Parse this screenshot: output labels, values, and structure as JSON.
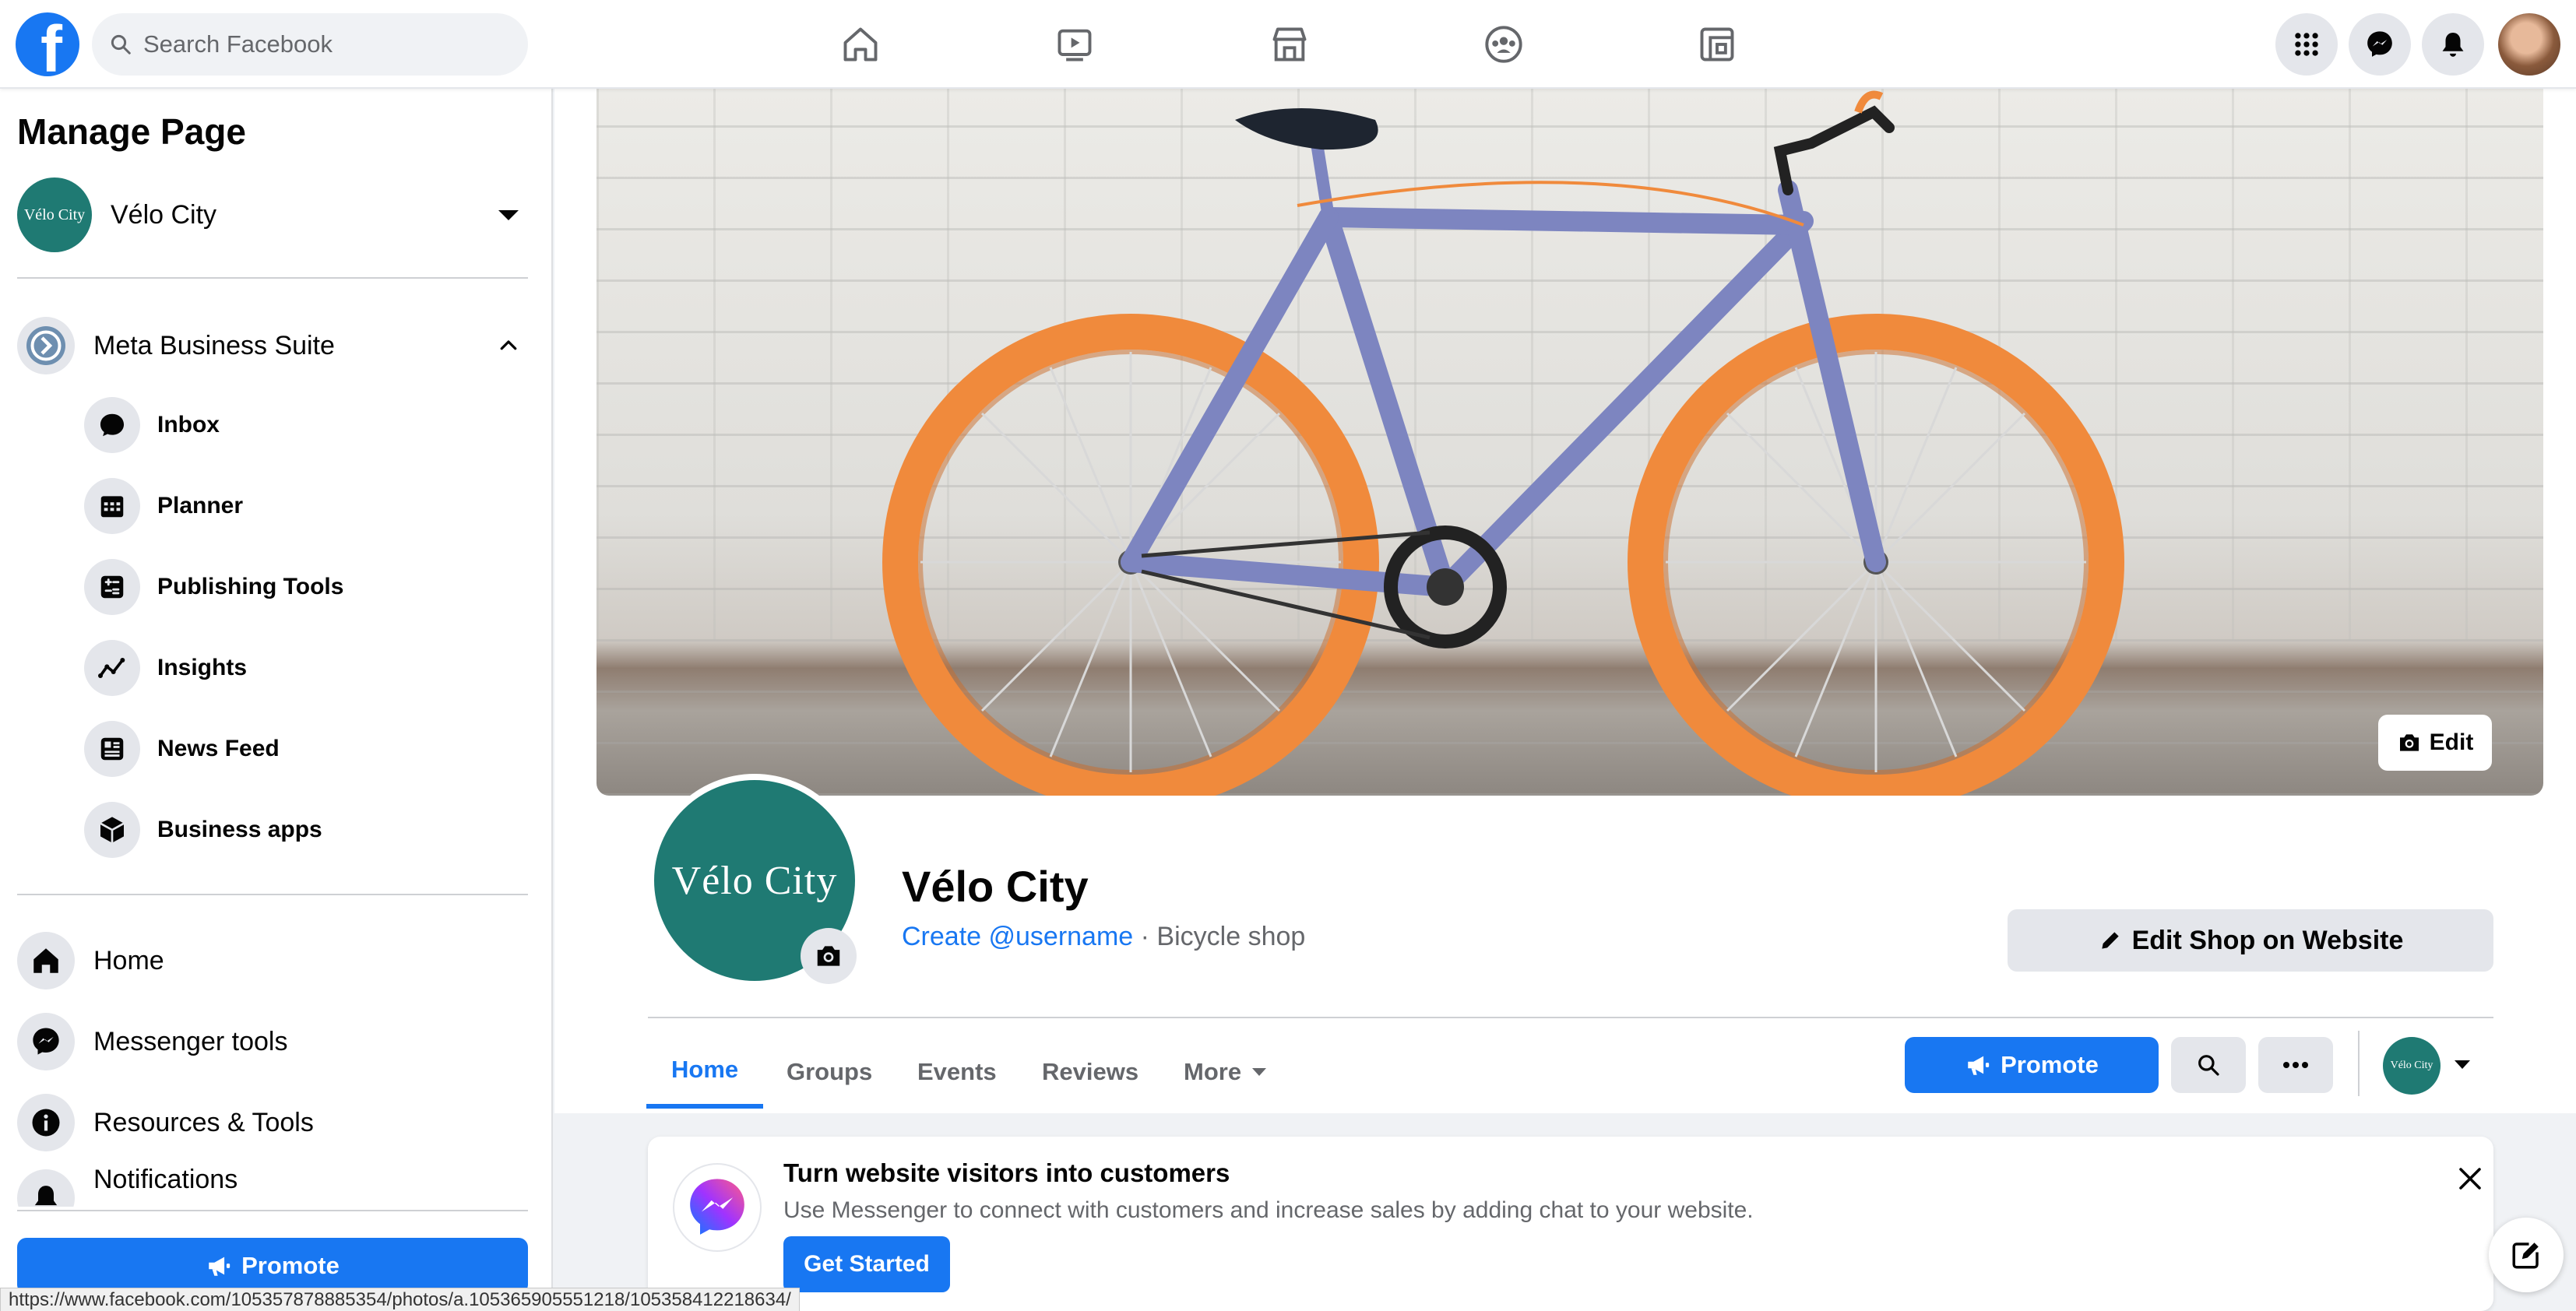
{
  "topbar": {
    "logo": "f",
    "search_placeholder": "Search Facebook",
    "nav_icons": [
      "home-icon",
      "watch-icon",
      "marketplace-icon",
      "groups-icon",
      "gaming-icon"
    ],
    "right_icons": [
      "menu-grid-icon",
      "messenger-icon",
      "notifications-icon"
    ]
  },
  "sidebar": {
    "title": "Manage Page",
    "page_name": "Vélo City",
    "page_avatar_text": "Vélo City",
    "business_suite": "Meta Business Suite",
    "suite_items": [
      {
        "label": "Inbox",
        "icon": "chat-bubble-icon"
      },
      {
        "label": "Planner",
        "icon": "calendar-icon"
      },
      {
        "label": "Publishing Tools",
        "icon": "publishing-tools-icon"
      },
      {
        "label": "Insights",
        "icon": "insights-icon"
      },
      {
        "label": "News Feed",
        "icon": "news-feed-icon"
      },
      {
        "label": "Business apps",
        "icon": "cube-icon"
      }
    ],
    "main_items": [
      {
        "label": "Home",
        "icon": "home-icon"
      },
      {
        "label": "Messenger tools",
        "icon": "messenger-icon"
      },
      {
        "label": "Resources & Tools",
        "icon": "info-icon"
      },
      {
        "label": "Notifications",
        "icon": "bell-icon"
      }
    ],
    "promote_label": "Promote"
  },
  "profile": {
    "cover_edit_label": "Edit",
    "avatar_text": "Vélo City",
    "name": "Vélo City",
    "username_link": "Create @username",
    "separator": " · ",
    "category": "Bicycle shop",
    "edit_shop_label": "Edit Shop on Website",
    "tabs": [
      "Home",
      "Groups",
      "Events",
      "Reviews",
      "More"
    ],
    "active_tab": "Home",
    "promote_label": "Promote",
    "mini_avatar_text": "Vélo City"
  },
  "promo": {
    "title": "Turn website visitors into customers",
    "text": "Use Messenger to connect with customers and increase sales by adding chat to your website.",
    "button": "Get Started"
  },
  "status_bar": {
    "url": "https://www.facebook.com/105357878885354/photos/a.105365905551218/105358412218634/"
  },
  "colors": {
    "brand_blue": "#1877f2",
    "teal_avatar": "#1f7a73",
    "tire_orange": "#f08a3c",
    "frame_blue": "#7d85c0"
  }
}
